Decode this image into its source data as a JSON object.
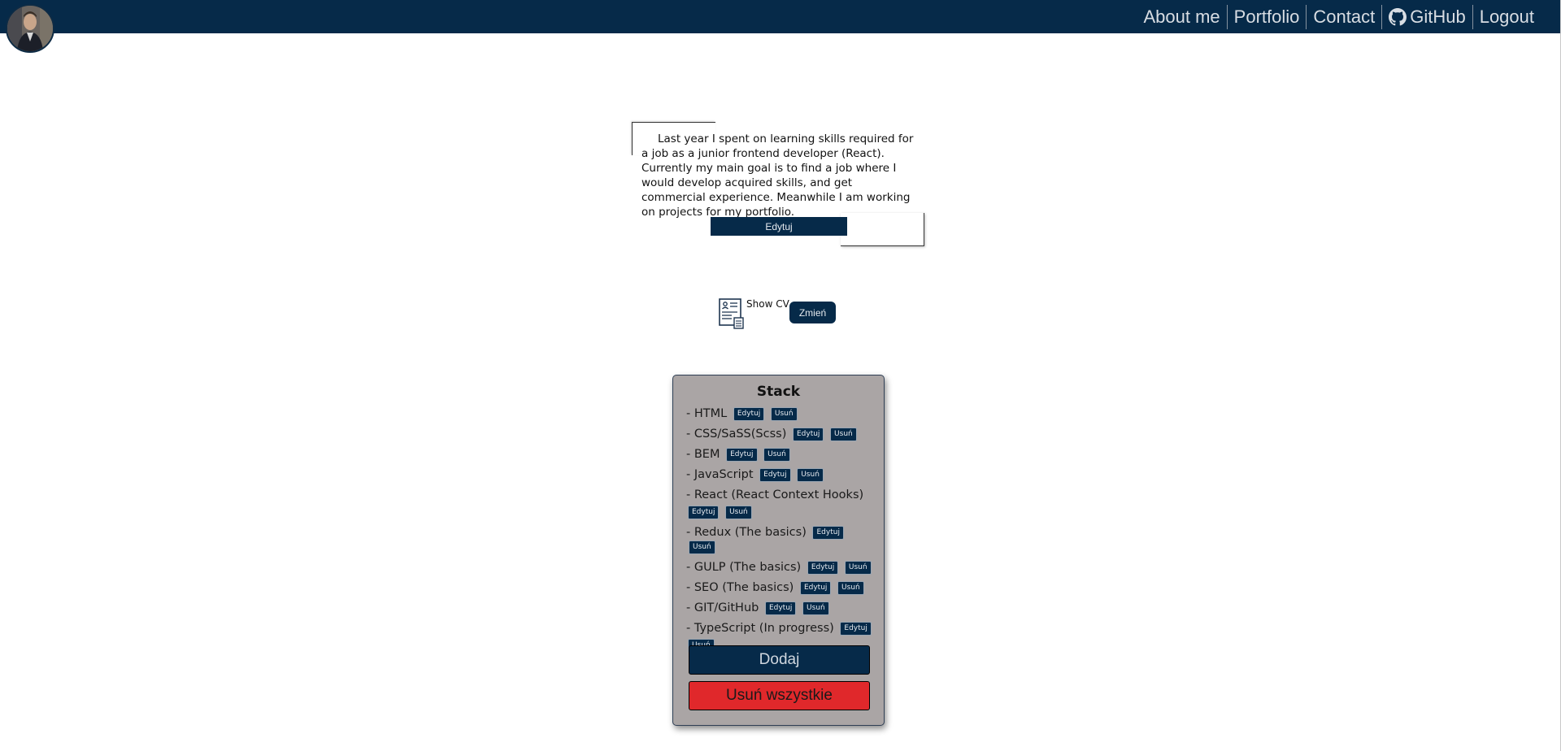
{
  "nav": {
    "items": [
      {
        "label": "About me"
      },
      {
        "label": "Portfolio"
      },
      {
        "label": "Contact"
      },
      {
        "label": "GitHub",
        "icon": "github-icon"
      },
      {
        "label": "Logout"
      }
    ]
  },
  "about": {
    "text": "Last year I spent on learning skills required for a job as a junior frontend developer (React). Currently my main goal is to find a job where I would develop acquired skills, and get commercial experience. Meanwhile I am working on projects for my portfolio.",
    "edit_label": "Edytuj"
  },
  "cv": {
    "label": "Show CV",
    "change_label": "Zmień",
    "icon": "cv-document-icon"
  },
  "stack": {
    "title": "Stack",
    "edit_label": "Edytuj",
    "delete_label": "Usuń",
    "items": [
      {
        "name": "- HTML"
      },
      {
        "name": "- CSS/SaSS(Scss)"
      },
      {
        "name": "- BEM"
      },
      {
        "name": "- JavaScript"
      },
      {
        "name": "- React (React Context Hooks)"
      },
      {
        "name": "- Redux (The basics)"
      },
      {
        "name": "- GULP (The basics)"
      },
      {
        "name": "- SEO (The basics)"
      },
      {
        "name": "- GIT/GitHub"
      },
      {
        "name": "- TypeScript (In progress)"
      }
    ],
    "add_label": "Dodaj",
    "delete_all_label": "Usuń wszystkie"
  },
  "colors": {
    "navbar": "#062a49",
    "card": "#aaa5a5",
    "danger": "#e0282b"
  }
}
